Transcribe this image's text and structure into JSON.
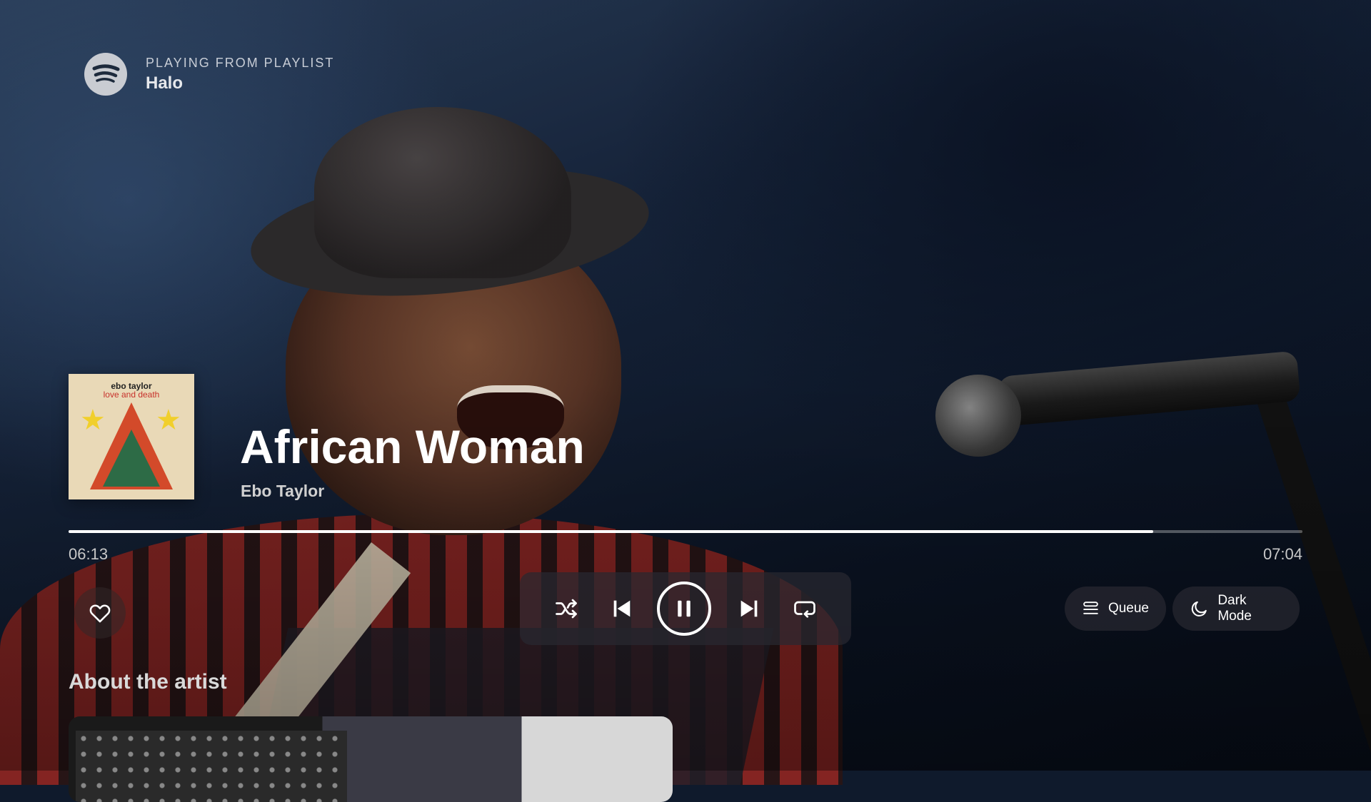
{
  "header": {
    "logo_icon": "spotify-logo-icon",
    "context_label": "PLAYING FROM PLAYLIST",
    "context_name": "Halo"
  },
  "track": {
    "title": "African Woman",
    "artist": "Ebo Taylor",
    "album_cover": {
      "artist_text": "ebo taylor",
      "title_text": "love and death"
    }
  },
  "playback": {
    "elapsed": "06:13",
    "total": "07:04",
    "progress_fraction": 0.879,
    "is_playing": true
  },
  "controls": {
    "like_icon": "heart-icon",
    "shuffle_icon": "shuffle-icon",
    "previous_icon": "skip-previous-icon",
    "play_pause_icon": "pause-icon",
    "next_icon": "skip-next-icon",
    "repeat_icon": "repeat-icon"
  },
  "actions": {
    "queue_label": "Queue",
    "queue_icon": "queue-list-icon",
    "dark_mode_label": "Dark Mode",
    "dark_mode_icon": "moon-icon"
  },
  "about": {
    "heading": "About the artist"
  },
  "colors": {
    "accent": "#ffffff",
    "background": "#0f1a2c"
  }
}
